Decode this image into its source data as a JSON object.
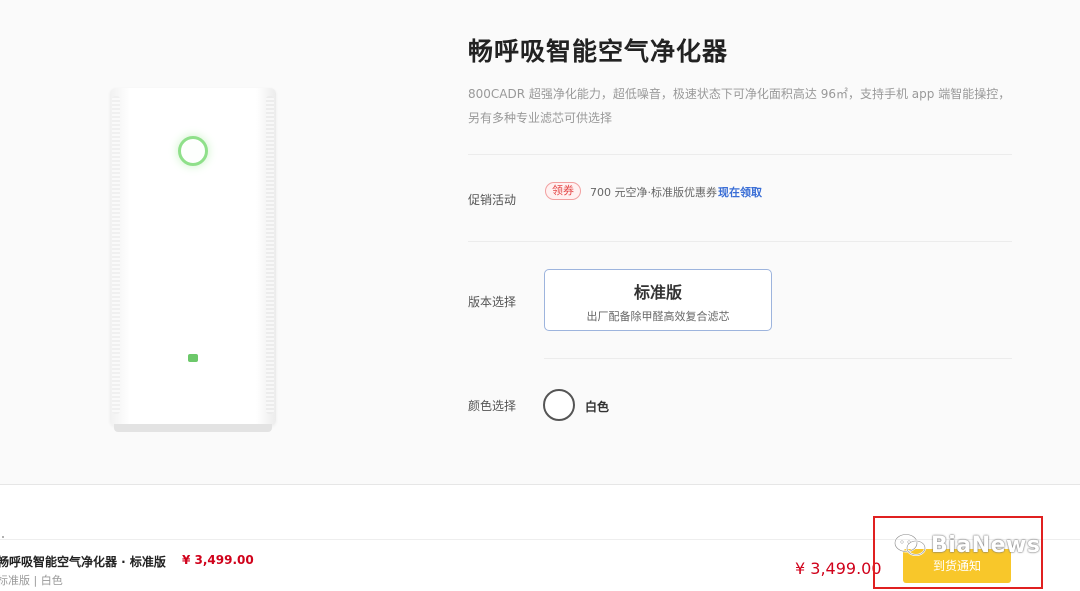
{
  "product": {
    "title": "畅呼吸智能空气净化器",
    "description": "800CADR 超强净化能力，超低噪音，极速状态下可净化面积高达 96㎡，支持手机 app 端智能操控，另有多种专业滤芯可供选择"
  },
  "promotion": {
    "label": "促销活动",
    "badge": "领券",
    "text": "700 元空净·标准版优惠券",
    "link": "现在领取"
  },
  "version": {
    "label": "版本选择",
    "options": [
      {
        "name": "标准版",
        "desc": "出厂配备除甲醛高效复合滤芯"
      }
    ]
  },
  "color": {
    "label": "颜色选择",
    "options": [
      {
        "name": "白色",
        "hex": "#ffffff"
      }
    ]
  },
  "summary": {
    "title": "畅呼吸智能空气净化器 · 标准版",
    "price": "¥ 3,499.00",
    "sub": "标准版 | 白色"
  },
  "checkout": {
    "total": "¥ 3,499.00",
    "button": "到货通知"
  },
  "watermark": {
    "text": "BiaNews"
  },
  "colors": {
    "accent_red": "#d0021b",
    "button_yellow": "#f8c72a",
    "link_blue": "#3a6ed6",
    "highlight_red": "#e02020"
  },
  "icons": [
    "air-purifier-image",
    "wechat-icon"
  ]
}
